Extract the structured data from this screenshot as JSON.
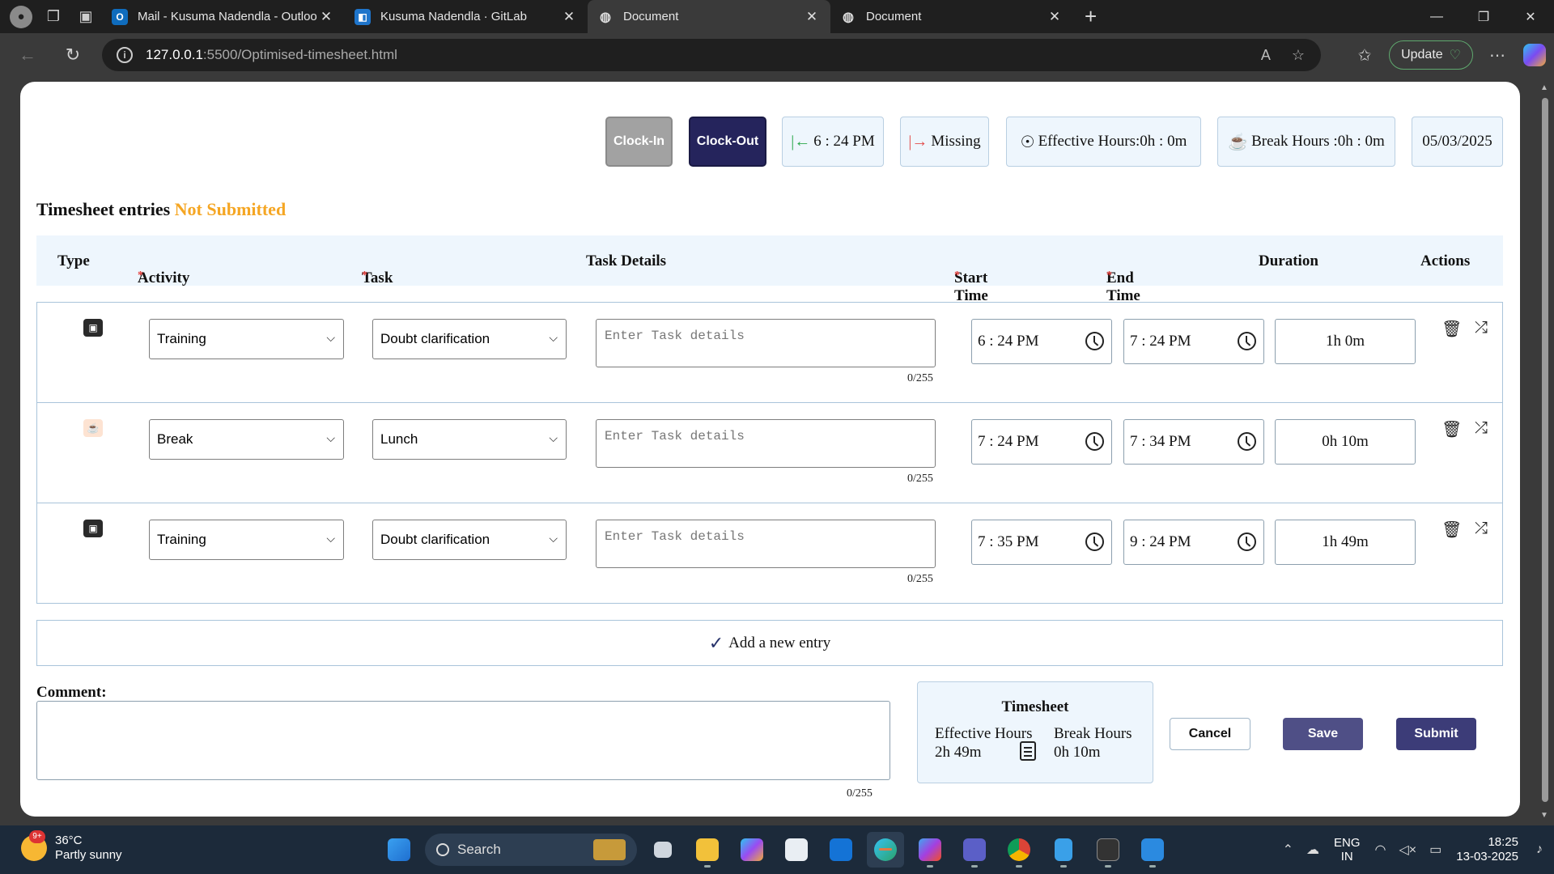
{
  "browser": {
    "tabs": [
      {
        "title": "Mail - Kusuma Nadendla - Outlook",
        "favicon": "outlook-icon",
        "active": false
      },
      {
        "title": "Kusuma Nadendla · GitLab",
        "favicon": "gitlab-icon",
        "active": false
      },
      {
        "title": "Document",
        "favicon": "globe-icon",
        "active": true
      },
      {
        "title": "Document",
        "favicon": "globe-icon",
        "active": false
      }
    ],
    "url_host": "127.0.0.1",
    "url_path": ":5500/Optimised-timesheet.html",
    "update_label": "Update"
  },
  "header": {
    "clock_in_label": "Clock-In",
    "clock_out_label": "Clock-Out",
    "clock_in_time": "6 : 24 PM",
    "clock_out_status": "Missing",
    "effective_hours": "Effective Hours:0h : 0m",
    "break_hours": "Break Hours :0h : 0m",
    "date": "05/03/2025"
  },
  "timesheet": {
    "title": "Timesheet entries",
    "status": "Not Submitted",
    "columns": {
      "type": "Type",
      "activity": "Activity",
      "task": "Task",
      "task_details": "Task Details",
      "start_time": "Start Time",
      "end_time": "End Time",
      "duration": "Duration",
      "actions": "Actions"
    },
    "required_marker": "*",
    "details_placeholder": "Enter Task details",
    "entries": [
      {
        "type": "training",
        "activity": "Training",
        "task": "Doubt clarification",
        "details_count": "0/255",
        "start": "6 : 24 PM",
        "end": "7 : 24 PM",
        "duration": "1h 0m"
      },
      {
        "type": "break",
        "activity": "Break",
        "task": "Lunch",
        "details_count": "0/255",
        "start": "7 : 24 PM",
        "end": "7 : 34 PM",
        "duration": "0h 10m"
      },
      {
        "type": "training",
        "activity": "Training",
        "task": "Doubt clarification",
        "details_count": "0/255",
        "start": "7 : 35 PM",
        "end": "9 : 24 PM",
        "duration": "1h 49m"
      }
    ],
    "add_entry_label": "Add a new entry"
  },
  "footer": {
    "comment_label": "Comment:",
    "comment_count": "0/255",
    "summary_title": "Timesheet",
    "summary_effective_label": "Effective Hours",
    "summary_effective_value": "2h 49m",
    "summary_break_label": "Break Hours",
    "summary_break_value": "0h 10m",
    "cancel_label": "Cancel",
    "save_label": "Save",
    "submit_label": "Submit"
  },
  "taskbar": {
    "weather_temp": "36°C",
    "weather_desc": "Partly sunny",
    "weather_badge": "9+",
    "search_label": "Search",
    "lang_line1": "ENG",
    "lang_line2": "IN",
    "time": "18:25",
    "date": "13-03-2025"
  },
  "colors": {
    "status_not_submitted": "#f5a623",
    "clock_out_button": "#25245c",
    "save_button": "#4f4f86",
    "submit_button": "#3c3c78",
    "header_bg": "#eef6fd"
  }
}
